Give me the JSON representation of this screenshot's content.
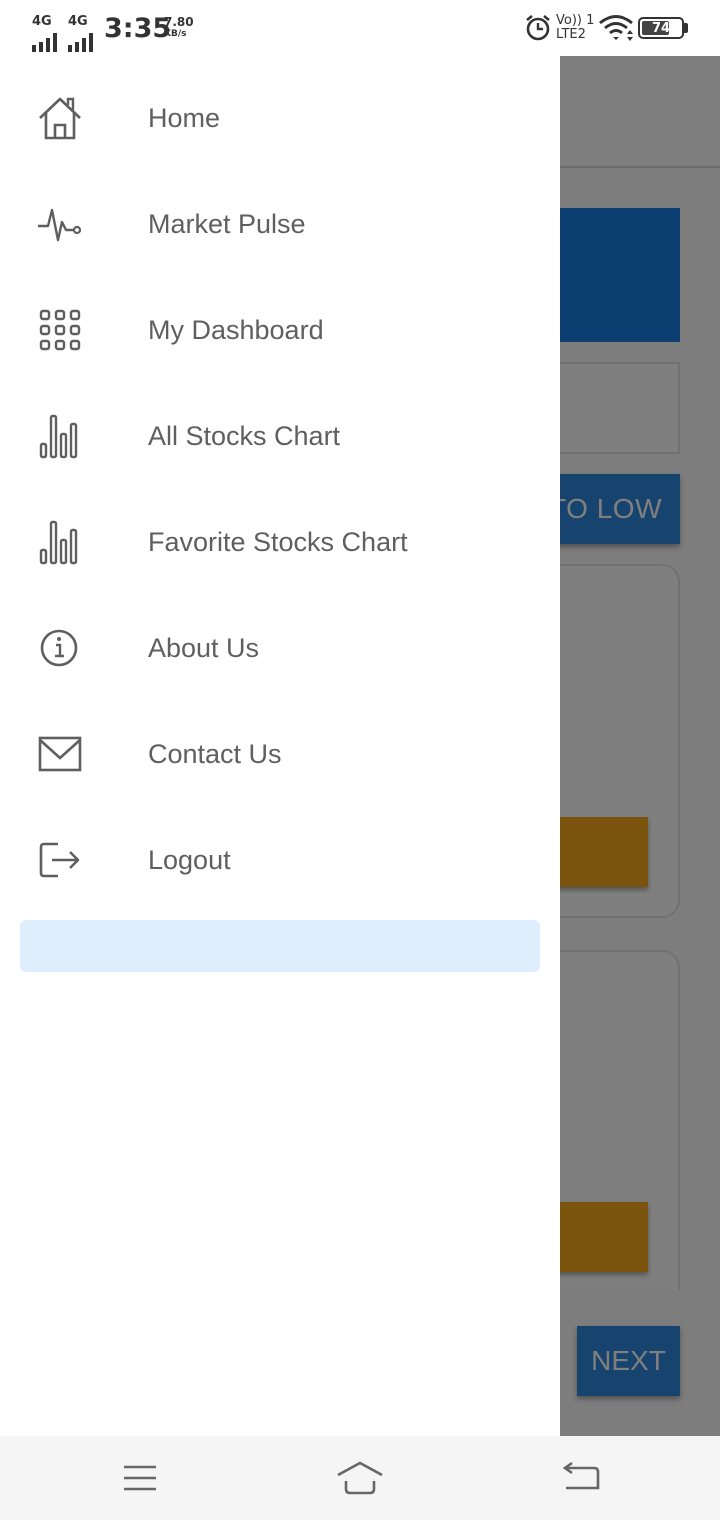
{
  "status_bar": {
    "network_1": "4G",
    "network_2": "4G",
    "time": "3:35",
    "speed_value": "7.80",
    "speed_unit": "KB/s",
    "volte_top": "Vo)) 1",
    "volte_bottom": "LTE2",
    "battery_level": "74"
  },
  "background": {
    "sort_button_label": "TO LOW",
    "next_button_label": "NEXT",
    "colors": {
      "banner": "#1d7fe6",
      "button_blue": "#2f86de",
      "button_orange": "#f4a61b"
    }
  },
  "drawer": {
    "items": [
      {
        "label": "Home",
        "icon": "home-icon"
      },
      {
        "label": "Market Pulse",
        "icon": "pulse-icon"
      },
      {
        "label": "My Dashboard",
        "icon": "grid-icon"
      },
      {
        "label": "All Stocks Chart",
        "icon": "bar-chart-icon"
      },
      {
        "label": "Favorite Stocks Chart",
        "icon": "bar-chart-icon"
      },
      {
        "label": "About Us",
        "icon": "info-icon"
      },
      {
        "label": "Contact Us",
        "icon": "mail-icon"
      },
      {
        "label": "Logout",
        "icon": "logout-icon"
      }
    ],
    "colors": {
      "text": "#5f5f5f",
      "banner": "#dfeefd"
    }
  },
  "nav_bar": {
    "buttons": [
      "menu",
      "home",
      "back"
    ]
  }
}
